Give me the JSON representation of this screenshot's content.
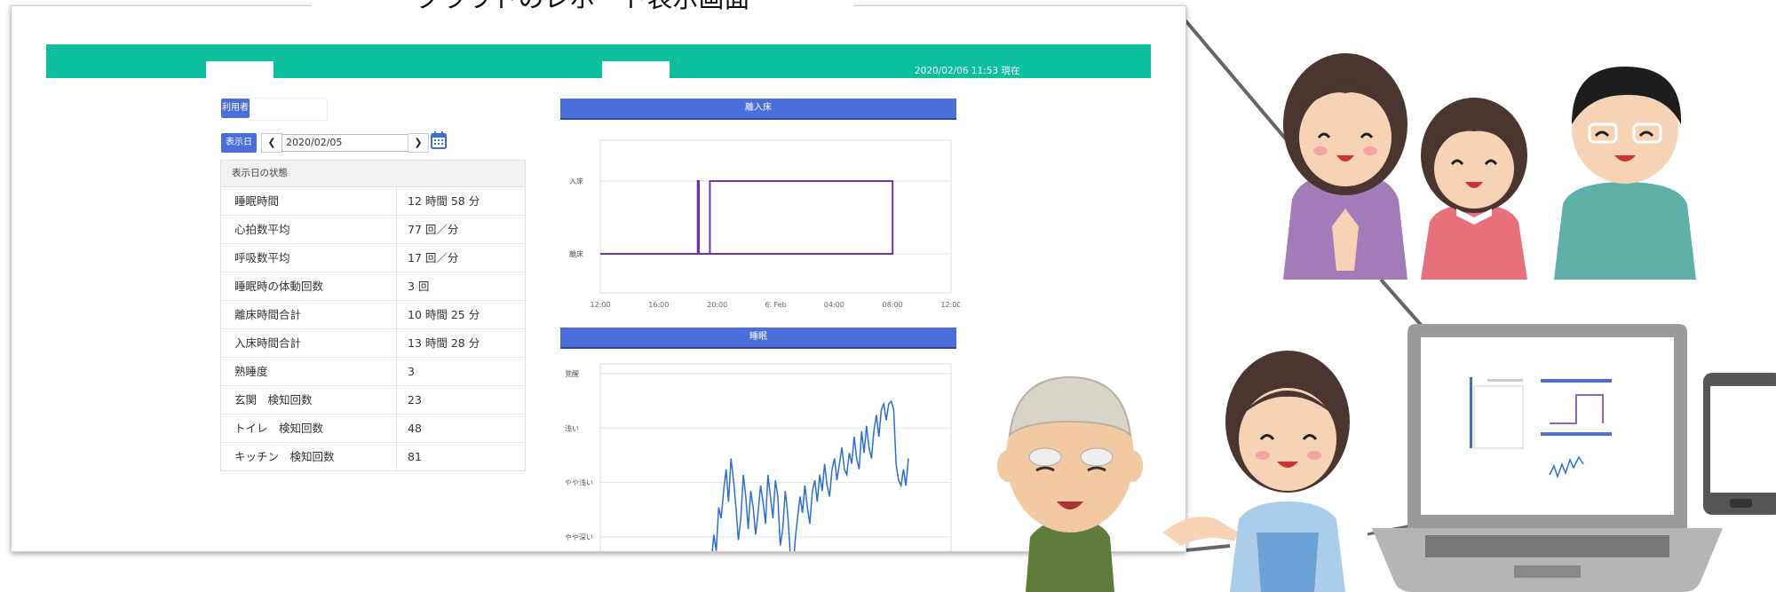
{
  "caption": "クラウドのレポート表示画面",
  "header": {
    "timestamp": "2020/02/06 11:53 現在"
  },
  "controls": {
    "user_label": "利用者",
    "date_label": "表示日",
    "prev_icon": "chevron-left-icon",
    "next_icon": "chevron-right-icon",
    "date_value": "2020/02/05",
    "calendar_icon": "calendar-icon"
  },
  "stats": {
    "header": "表示日の状態",
    "rows": [
      {
        "label": "睡眠時間",
        "value": "12 時間 58 分"
      },
      {
        "label": "心拍数平均",
        "value": "77 回／分"
      },
      {
        "label": "呼吸数平均",
        "value": "17 回／分"
      },
      {
        "label": "睡眠時の体動回数",
        "value": "3 回"
      },
      {
        "label": "離床時間合計",
        "value": "10 時間 25 分"
      },
      {
        "label": "入床時間合計",
        "value": "13 時間 28 分"
      },
      {
        "label": "熟睡度",
        "value": "3"
      },
      {
        "label": "玄関　検知回数",
        "value": "23"
      },
      {
        "label": "トイレ　検知回数",
        "value": "48"
      },
      {
        "label": "キッチン　検知回数",
        "value": "81"
      }
    ]
  },
  "chart_data": [
    {
      "type": "line",
      "title": "離入床",
      "y_categories": [
        "離床",
        "入床"
      ],
      "x_ticks": [
        "12:00",
        "16:00",
        "20:00",
        "6. Feb",
        "04:00",
        "08:00",
        "12:00"
      ],
      "step_points": [
        {
          "t": "17:40",
          "state": "離床"
        },
        {
          "t": "18:40",
          "state": "離床"
        },
        {
          "t": "18:40",
          "state": "入床"
        },
        {
          "t": "18:45",
          "state": "入床"
        },
        {
          "t": "18:45",
          "state": "離床"
        },
        {
          "t": "19:30",
          "state": "離床"
        },
        {
          "t": "19:30",
          "state": "入床"
        },
        {
          "t": "08:00",
          "state": "入床"
        },
        {
          "t": "08:00",
          "state": "離床"
        },
        {
          "t": "12:00",
          "state": "離床"
        }
      ],
      "color": "#6a33b0"
    },
    {
      "type": "line",
      "title": "睡眠",
      "y_categories": [
        "やや深い",
        "やや浅い",
        "浅い",
        "覚醒"
      ],
      "color": "#2a6fd6",
      "values": [
        1.0,
        1.5,
        1.2,
        2.0,
        1.8,
        2.3,
        2.7,
        2.1,
        2.9,
        2.5,
        2.0,
        1.4,
        1.8,
        2.6,
        2.2,
        1.6,
        2.3,
        2.0,
        1.5,
        1.9,
        2.4,
        2.1,
        1.7,
        2.6,
        2.2,
        1.8,
        2.5,
        2.2,
        1.3,
        1.6,
        2.3,
        1.9,
        1.2,
        0.6,
        1.4,
        1.8,
        2.2,
        1.9,
        2.4,
        2.0,
        1.7,
        2.3,
        2.5,
        2.1,
        2.6,
        2.3,
        2.8,
        2.4,
        2.2,
        2.7,
        2.9,
        2.5,
        2.8,
        3.1,
        2.7,
        2.6,
        3.0,
        2.8,
        3.3,
        2.9,
        2.7,
        3.4,
        3.0,
        3.5,
        3.1,
        2.9,
        3.4,
        3.7,
        3.3,
        3.8,
        3.9,
        3.6,
        3.9,
        3.95,
        3.8,
        2.8,
        2.5,
        2.4,
        2.7,
        2.4,
        2.9
      ]
    }
  ],
  "illustrations": {
    "family": "family-icon",
    "elderly_man": "elderly-man-icon",
    "caregiver": "caregiver-icon",
    "laptop": "laptop-icon",
    "smartphone": "smartphone-icon"
  }
}
